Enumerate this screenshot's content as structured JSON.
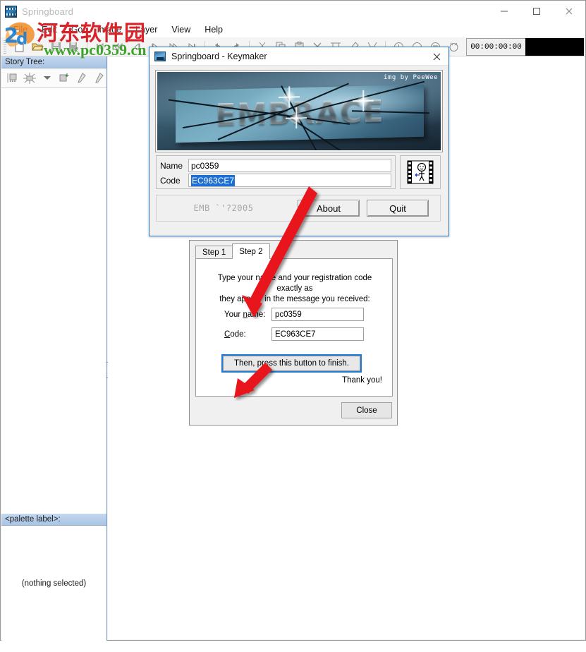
{
  "app": {
    "title": "Springboard",
    "icon": "filmstrip-icon",
    "menus": [
      "File",
      "Edit",
      "Go",
      "Image",
      "Layer",
      "View",
      "Help"
    ],
    "window_controls": [
      {
        "name": "minimize-button",
        "glyph": "minimize-icon"
      },
      {
        "name": "maximize-button",
        "glyph": "maximize-icon"
      },
      {
        "name": "close-button",
        "glyph": "close-icon"
      }
    ],
    "toolbar": {
      "buttons": [
        {
          "name": "new-icon"
        },
        {
          "name": "open-icon"
        },
        {
          "name": "save-icon"
        },
        {
          "name": "save-as-icon"
        },
        {
          "name": "go-first-icon"
        },
        {
          "name": "rewind-icon"
        },
        {
          "name": "step-back-icon"
        },
        {
          "name": "step-forward-icon"
        },
        {
          "name": "fast-forward-icon"
        },
        {
          "name": "go-last-icon"
        },
        {
          "name": "undo-icon"
        },
        {
          "name": "redo-icon"
        },
        {
          "name": "cut-icon"
        },
        {
          "name": "copy-icon"
        },
        {
          "name": "paste-icon"
        },
        {
          "name": "delete-icon"
        },
        {
          "name": "crop-icon"
        },
        {
          "name": "pen-icon"
        },
        {
          "name": "brush-icon"
        },
        {
          "name": "zoom-in-icon"
        },
        {
          "name": "zoom-out-icon"
        },
        {
          "name": "zoom-fit-icon"
        },
        {
          "name": "zoom-reset-icon"
        },
        {
          "name": "frame-one-icon"
        },
        {
          "name": "curve-icon"
        }
      ],
      "timecode": "00:00:00:00"
    }
  },
  "sidebar": {
    "story_tree_label": "Story Tree:",
    "story_tools": [
      {
        "name": "insert-node-icon"
      },
      {
        "name": "effects-icon"
      },
      {
        "name": "dropdown-arrow-icon"
      },
      {
        "name": "new-node-icon"
      },
      {
        "name": "pen-tool-icon"
      },
      {
        "name": "pencil-tool-icon"
      }
    ],
    "palette_label": "<palette label>:",
    "nothing_selected": "(nothing selected)"
  },
  "watermark": {
    "cn_text": "河东软件园",
    "url_text": "www.pc0359.cn"
  },
  "keymaker": {
    "title": "Springboard - Keymaker",
    "icon": "app-icon",
    "close_icon": "close-icon",
    "banner": {
      "wordmark": "EMBRACE",
      "credit": "img by PeeWee"
    },
    "name_label": "Name",
    "name_value": "pc0359",
    "code_label": "Code",
    "code_value": "EC963CE7",
    "film_icon": "filmstrip-figure-icon",
    "footer_text": "EMB `'?2005",
    "about_label": "About",
    "quit_label": "Quit"
  },
  "registration": {
    "tabs": [
      {
        "label": "Step 1",
        "active": false
      },
      {
        "label": "Step 2",
        "active": true
      }
    ],
    "instruction_line1": "Type your name and your registration code exactly as",
    "instruction_line2": "they appear in the message you received:",
    "name_label_pre": "Your ",
    "name_label_underlined": "n",
    "name_label_post": "ame:",
    "name_value": "pc0359",
    "code_label_underlined": "C",
    "code_label_post": "ode:",
    "code_value": "EC963CE7",
    "finish_label": "Then, press this button to finish.",
    "thankyou_label": "Thank you!",
    "close_label": "Close"
  },
  "colors": {
    "accent": "#1f7cd6",
    "annotation": "#e8121a",
    "selection": "#1b6fd6",
    "watermark_red": "#d8232a",
    "watermark_green": "#3ea32c"
  }
}
